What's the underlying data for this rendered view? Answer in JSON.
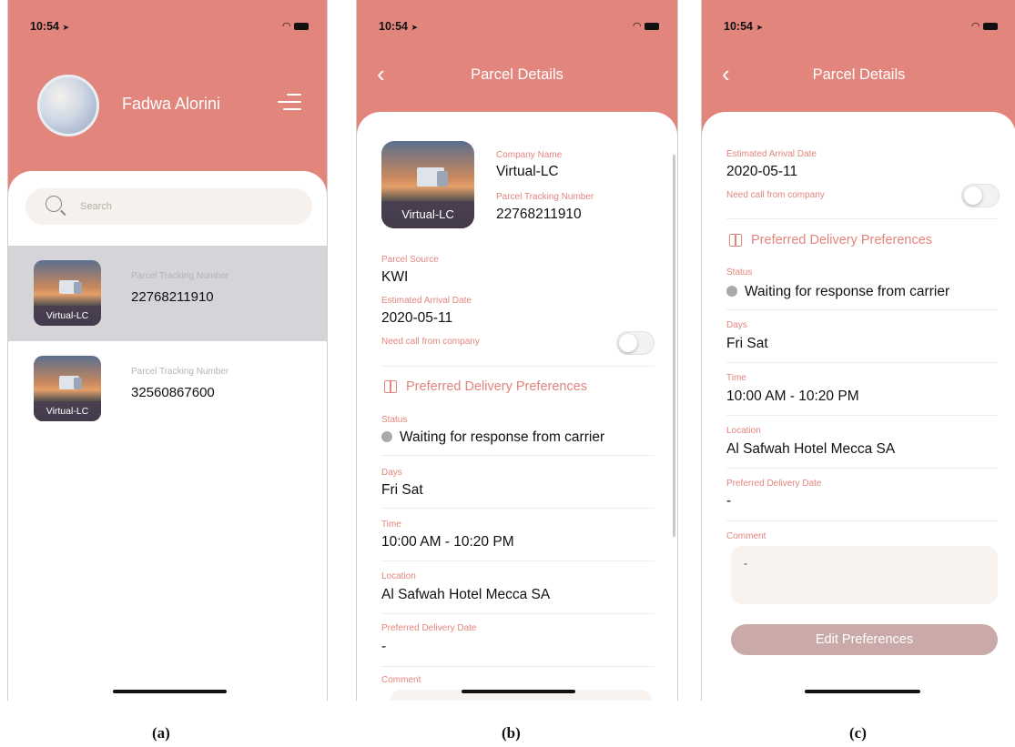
{
  "status_bar": {
    "time": "10:54",
    "signal": "....",
    "location_glyph": "➤"
  },
  "screen_a": {
    "user_name": "Fadwa Alorini",
    "search_placeholder": "Search",
    "parcels": [
      {
        "thumb_label": "Virtual-LC",
        "label": "Parcel Tracking Number",
        "value": "22768211910",
        "selected": true
      },
      {
        "thumb_label": "Virtual-LC",
        "label": "Parcel Tracking Number",
        "value": "32560867600",
        "selected": false
      }
    ]
  },
  "screen_b": {
    "title": "Parcel Details",
    "back_glyph": "‹",
    "thumb_label": "Virtual-LC",
    "company_label": "Company Name",
    "company_value": "Virtual-LC",
    "tracking_label": "Parcel Tracking Number",
    "tracking_value": "22768211910",
    "source_label": "Parcel Source",
    "source_value": "KWI",
    "eta_label": "Estimated Arrival Date",
    "eta_value": "2020-05-11",
    "call_label": "Need call from company",
    "pref_title": "Preferred Delivery Preferences",
    "status_label": "Status",
    "status_value": "Waiting for response from carrier",
    "days_label": "Days",
    "days_value": "Fri Sat",
    "time_label": "Time",
    "time_value": "10:00 AM - 10:20 PM",
    "location_label": "Location",
    "location_value": "Al Safwah Hotel Mecca SA",
    "pdd_label": "Preferred Delivery Date",
    "pdd_value": "-",
    "comment_label": "Comment"
  },
  "screen_c": {
    "title": "Parcel Details",
    "back_glyph": "‹",
    "eta_label": "Estimated Arrival Date",
    "eta_value": "2020-05-11",
    "call_label": "Need call from company",
    "pref_title": "Preferred Delivery Preferences",
    "status_label": "Status",
    "status_value": "Waiting for response from carrier",
    "days_label": "Days",
    "days_value": "Fri Sat",
    "time_label": "Time",
    "time_value": "10:00 AM - 10:20 PM",
    "location_label": "Location",
    "location_value": "Al Safwah Hotel Mecca SA",
    "pdd_label": "Preferred Delivery Date",
    "pdd_value": "-",
    "comment_label": "Comment",
    "comment_value": "-",
    "edit_button": "Edit Preferences"
  },
  "captions": [
    "(a)",
    "(b)",
    "(c)"
  ],
  "colors": {
    "accent": "#e2857c",
    "selected_row": "#d4d4d9",
    "button_disabled": "#c9aaa8",
    "input_bg": "#f6f1ec"
  }
}
